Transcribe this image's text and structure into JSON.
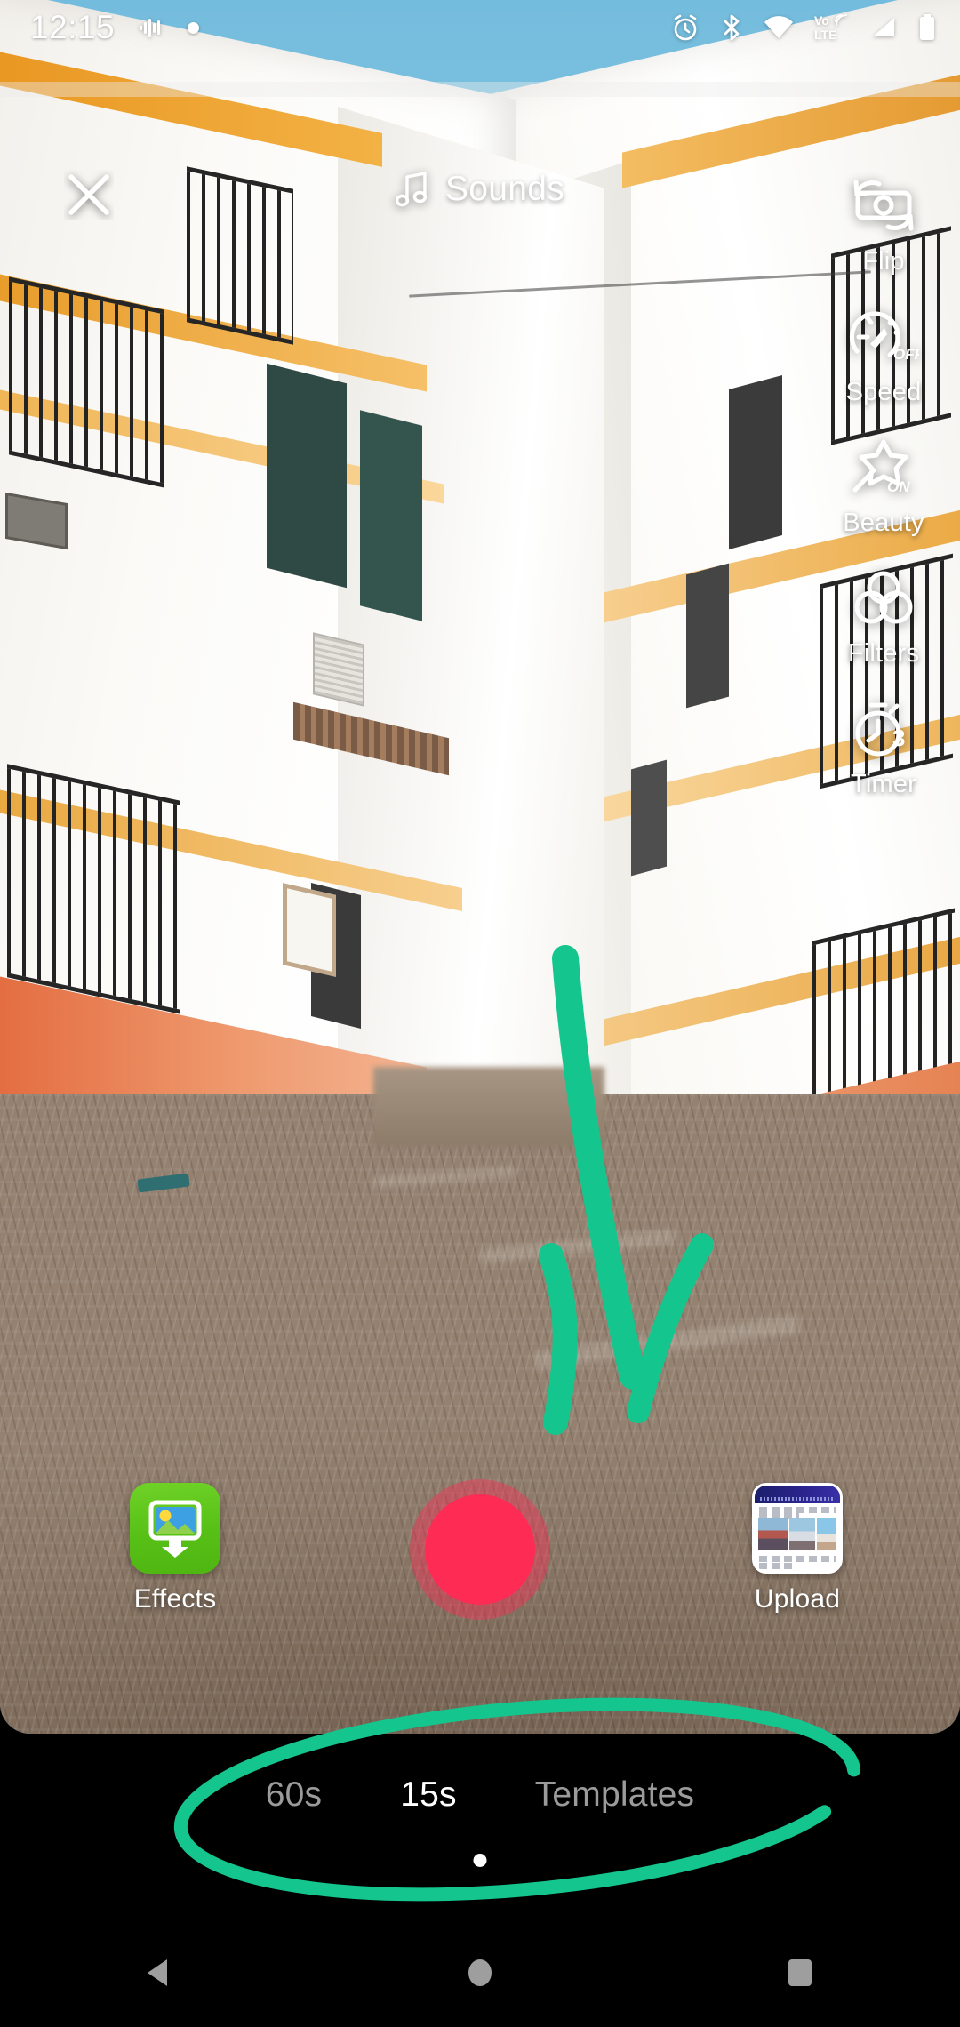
{
  "status_bar": {
    "time": "12:15",
    "icons": [
      "sound-wave-icon",
      "notification-dot-icon",
      "alarm-icon",
      "bluetooth-icon",
      "wifi-icon",
      "volte-icon",
      "signal-icon",
      "battery-icon"
    ],
    "volte_label_top": "Vo",
    "volte_label_bottom": "LTE"
  },
  "top_bar": {
    "close_label": "Close",
    "close_icon": "close-icon",
    "sounds_label": "Sounds",
    "sounds_icon": "music-note-icon"
  },
  "tool_rail": {
    "items": [
      {
        "label": "Flip",
        "icon": "camera-flip-icon",
        "badge": ""
      },
      {
        "label": "Speed",
        "icon": "speedometer-icon",
        "badge": "OFF"
      },
      {
        "label": "Beauty",
        "icon": "magic-star-icon",
        "badge": "ON"
      },
      {
        "label": "Filters",
        "icon": "filters-circles-icon",
        "badge": ""
      },
      {
        "label": "Timer",
        "icon": "stopwatch-icon",
        "badge": "3"
      }
    ]
  },
  "controls": {
    "effects_label": "Effects",
    "effects_icon": "effects-gallery-icon",
    "record_label": "Record",
    "record_icon": "record-button-icon",
    "upload_label": "Upload",
    "upload_icon": "upload-thumbnail-icon"
  },
  "mode_bar": {
    "tabs": [
      {
        "label": "60s",
        "active": false
      },
      {
        "label": "15s",
        "active": true
      },
      {
        "label": "Templates",
        "active": false
      }
    ]
  },
  "nav_bar": {
    "back_icon": "back-triangle-icon",
    "home_icon": "home-circle-icon",
    "recents_icon": "recents-square-icon"
  },
  "annotation": {
    "arrow_color": "#14c68d",
    "ellipse_color": "#14c68d",
    "arrow_target": "record-button",
    "ellipse_target": "mode-bar"
  },
  "colors": {
    "record_fill": "#fe2c55",
    "record_ring": "rgba(254,44,85,0.42)",
    "accent_green": "#14c68d",
    "effects_green": "#57c016",
    "tab_active": "#ffffff",
    "tab_inactive": "#9b9b9b",
    "background": "#000000"
  }
}
